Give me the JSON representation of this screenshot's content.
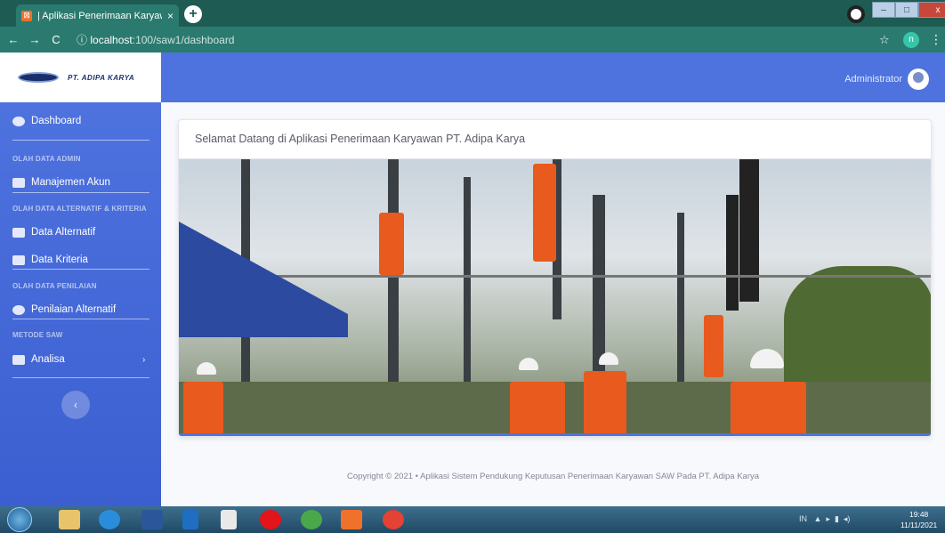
{
  "browser": {
    "tab_title": "| Aplikasi Penerimaan Karyawan",
    "tab_close": "×",
    "new_tab": "+",
    "url_host": "localhost",
    "url_path": ":100/saw1/dashboard",
    "profile_letter": "n",
    "window_controls": [
      "–",
      "□",
      "x"
    ]
  },
  "brand": {
    "name": "PT. ADIPA KARYA"
  },
  "sidebar": {
    "dashboard": "Dashboard",
    "head_admin": "OLAH DATA ADMIN",
    "manajemen_akun": "Manajemen Akun",
    "head_alternatif": "OLAH DATA ALTERNATIF & KRITERIA",
    "data_alternatif": "Data Alternatif",
    "data_kriteria": "Data Kriteria",
    "head_penilaian": "OLAH DATA PENILAIAN",
    "penilaian_alternatif": "Penilaian Alternatif",
    "head_metode": "METODE SAW",
    "analisa": "Analisa",
    "analisa_chevron": "›",
    "collapse": "‹"
  },
  "topbar": {
    "username": "Administrator"
  },
  "main": {
    "welcome": "Selamat Datang di Aplikasi Penerimaan Karyawan PT. Adipa Karya"
  },
  "footer": {
    "text": "Copyright © 2021 • Aplikasi Sistem Pendukung Keputusan Penerimaan Karyawan SAW Pada PT. Adipa Karya"
  },
  "taskbar": {
    "tray_lang": "IN",
    "time": "19:48",
    "date": "11/11/2021"
  },
  "colors": {
    "primary": "#4e73df",
    "browser_dark": "#1e5b53",
    "browser_tab": "#2b7a6f"
  }
}
